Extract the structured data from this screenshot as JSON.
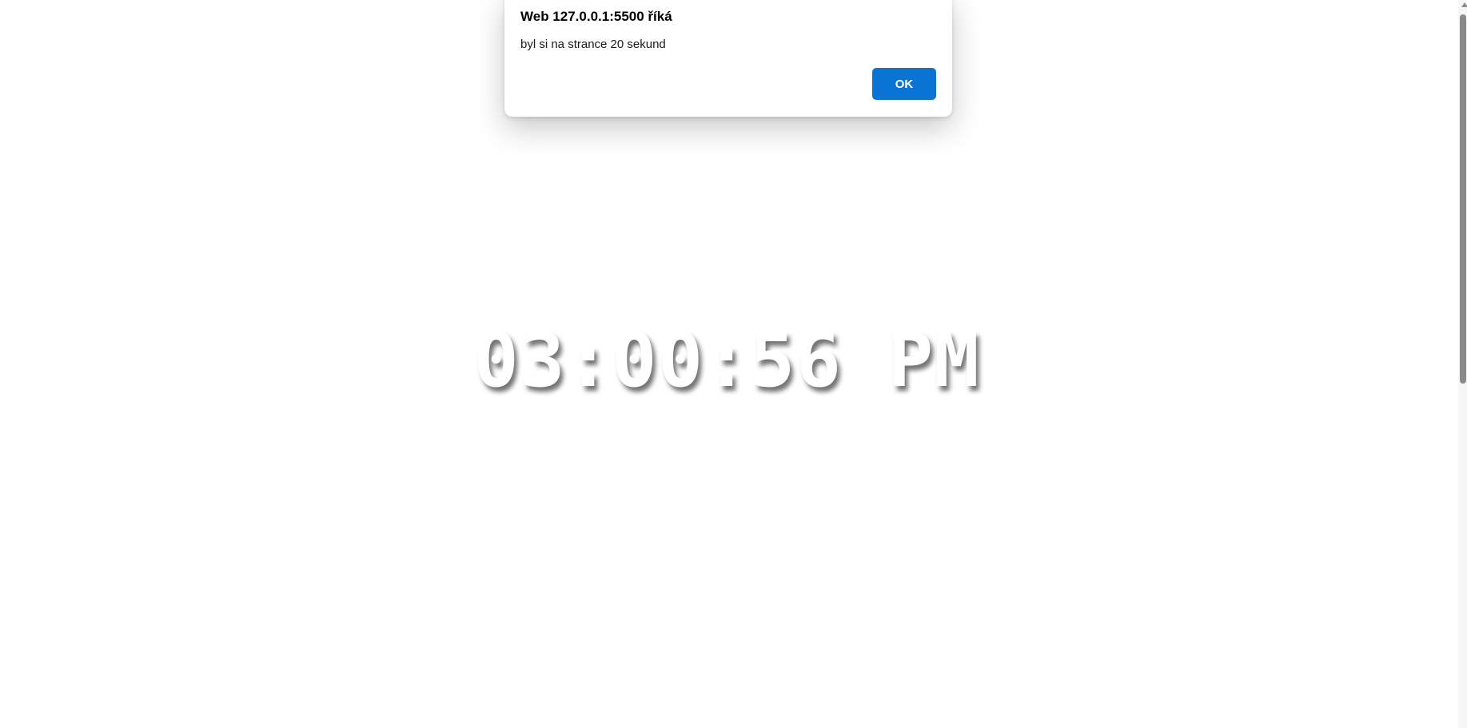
{
  "clock": {
    "time": "03:00:56 PM"
  },
  "alert": {
    "title": "Web 127.0.0.1:5500 říká",
    "message": "byl si na strance 20 sekund",
    "ok_label": "OK"
  },
  "colors": {
    "accent": "#0a74d4",
    "background": "#ffffff",
    "clock_text": "#ffffff"
  },
  "scrollbar": {
    "icon": "chevron-up-icon"
  }
}
